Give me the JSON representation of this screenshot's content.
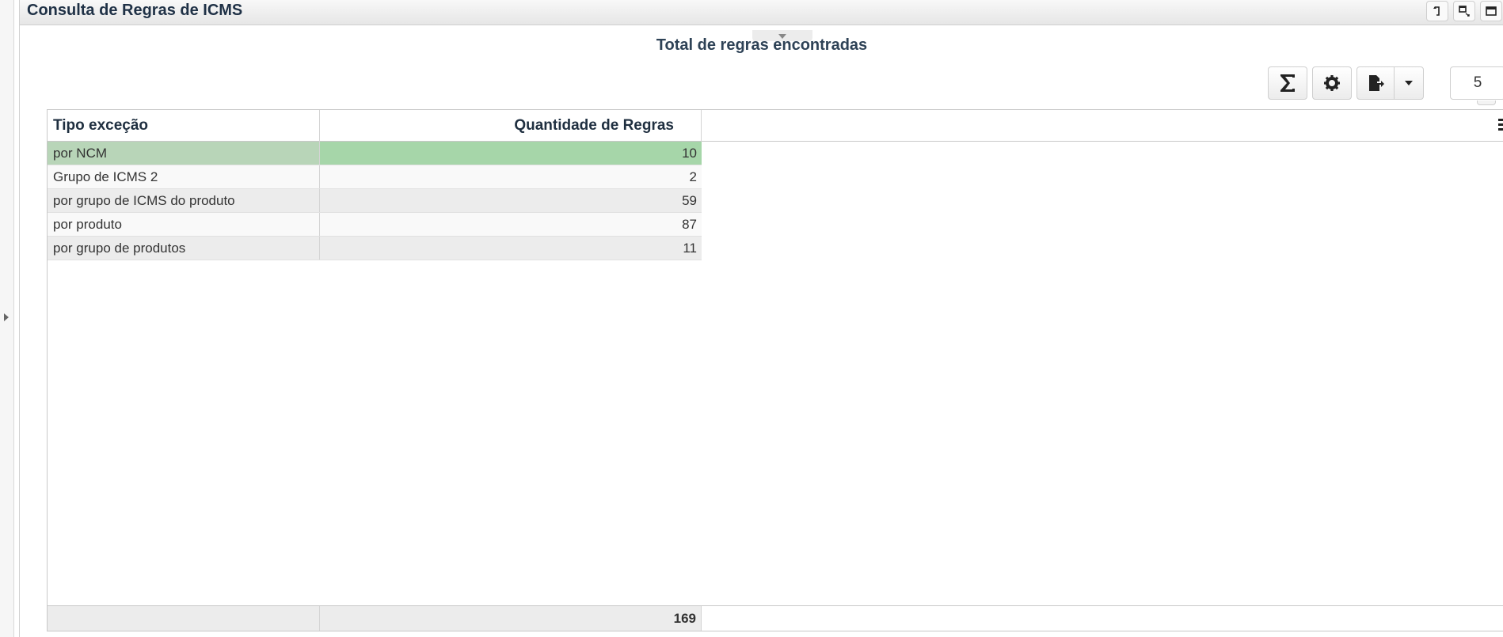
{
  "panel": {
    "title": "Consulta de Regras de ICMS",
    "header_buttons": [
      {
        "icon": "undo-icon"
      },
      {
        "icon": "restore-window-icon"
      },
      {
        "icon": "maximize-icon"
      }
    ]
  },
  "section": {
    "title": "Total de regras encontradas"
  },
  "toolbar": {
    "sum_icon": "sigma-icon",
    "settings_icon": "gear-icon",
    "export_icon": "export-file-icon",
    "export_dropdown_icon": "caret-down-icon",
    "page_size": "5"
  },
  "grid": {
    "columns": [
      "Tipo exceção",
      "Quantidade de Regras"
    ],
    "rows": [
      {
        "tipo": "por NCM",
        "quantidade": "10",
        "selected": true
      },
      {
        "tipo": "Grupo de ICMS 2",
        "quantidade": "2"
      },
      {
        "tipo": "por grupo de ICMS do produto",
        "quantidade": "59"
      },
      {
        "tipo": "por produto",
        "quantidade": "87"
      },
      {
        "tipo": "por grupo de produtos",
        "quantidade": "11"
      }
    ],
    "total": "169"
  },
  "colors": {
    "selected_row": "#a6d6a9",
    "title_text": "#1f3146"
  }
}
